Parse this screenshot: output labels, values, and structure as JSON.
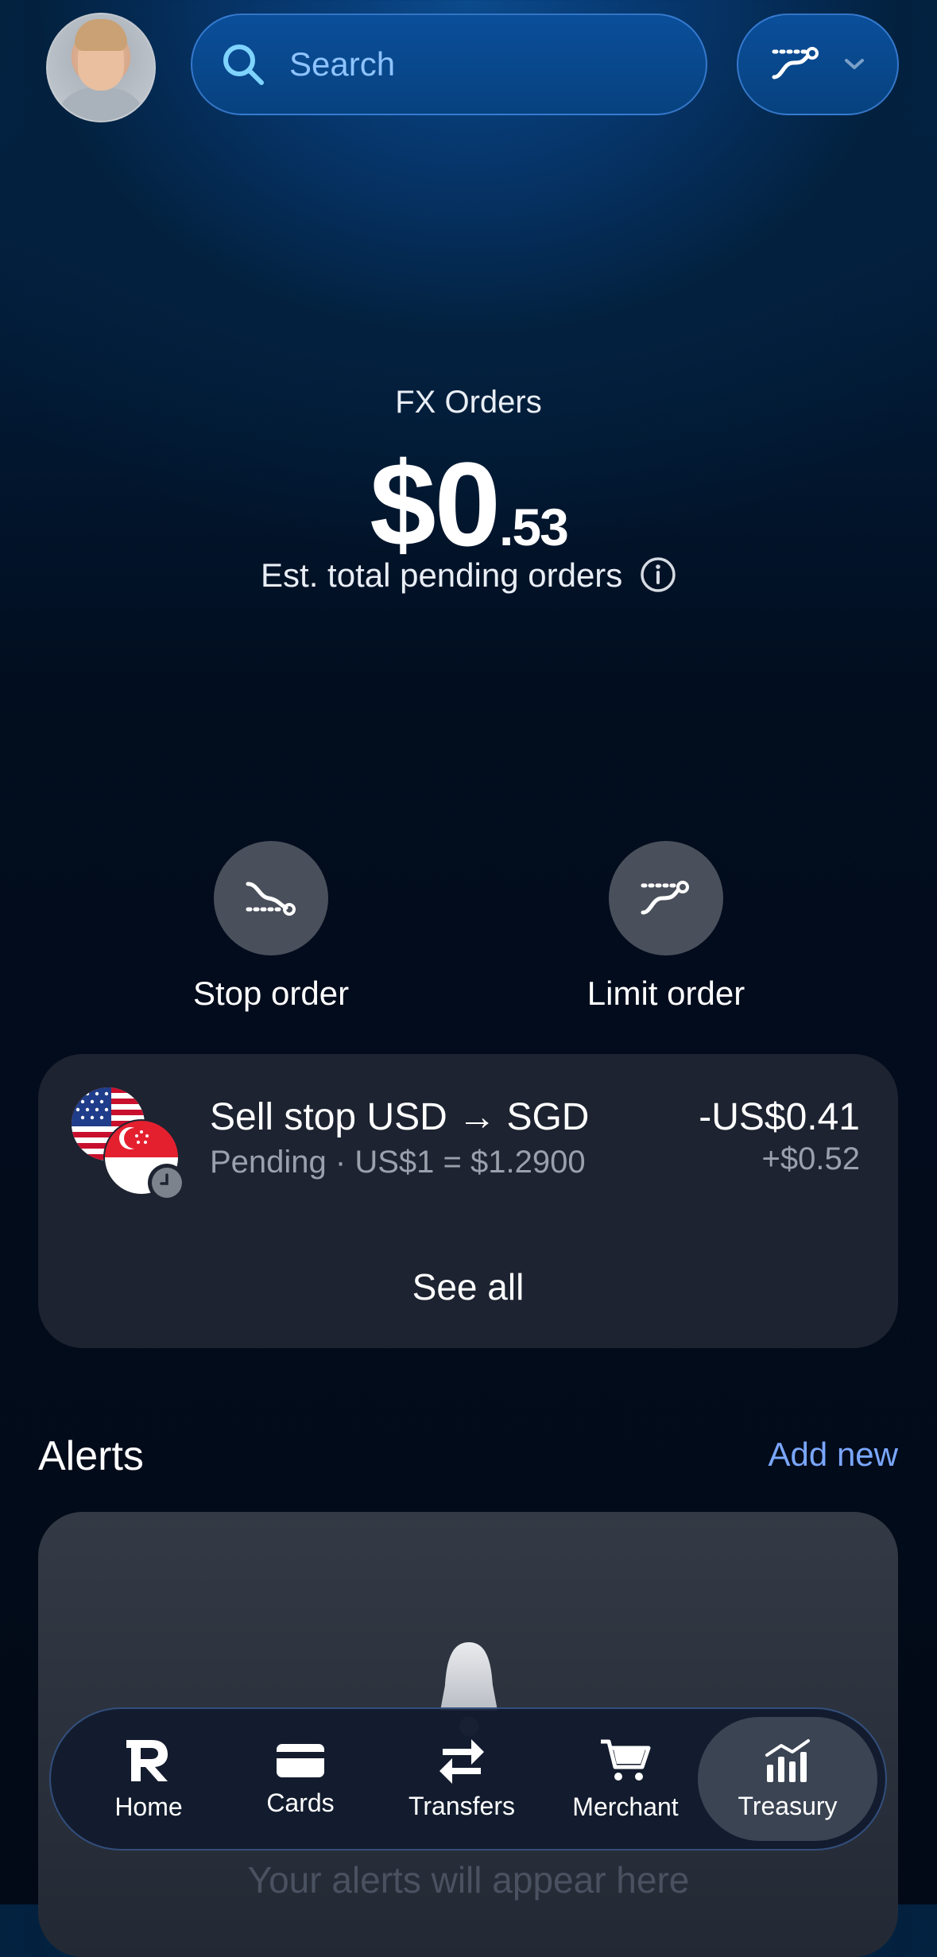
{
  "header": {
    "search_placeholder": "Search",
    "icons": [
      "avatar",
      "search-icon",
      "limit-order-icon",
      "chevron-down-icon"
    ]
  },
  "hero": {
    "label": "FX Orders",
    "amount_main": "$0",
    "amount_cents": ".53",
    "subtitle": "Est. total pending orders"
  },
  "actions": [
    {
      "label": "Stop order",
      "icon": "stop-order-icon"
    },
    {
      "label": "Limit order",
      "icon": "limit-order-icon"
    }
  ],
  "orders": {
    "items": [
      {
        "title": "Sell stop USD → SGD",
        "subtitle": "Pending · US$1 = $1.2900",
        "amount": "-US$0.41",
        "amount_converted": "+$0.52",
        "flags": [
          "us-flag",
          "sg-flag"
        ],
        "status_icon": "clock-icon"
      }
    ],
    "see_all_label": "See all"
  },
  "alerts": {
    "title": "Alerts",
    "add_label": "Add new",
    "empty_text": "Your alerts will appear here"
  },
  "tabs": [
    {
      "label": "Home",
      "icon": "revolut-logo-icon"
    },
    {
      "label": "Cards",
      "icon": "card-icon"
    },
    {
      "label": "Transfers",
      "icon": "transfers-icon"
    },
    {
      "label": "Merchant",
      "icon": "cart-icon"
    },
    {
      "label": "Treasury",
      "icon": "chart-bars-icon",
      "active": true
    }
  ],
  "colors": {
    "accent": "#7aa7ff",
    "card_bg": "#1d2330",
    "search_bg": "#0a4e9a"
  }
}
